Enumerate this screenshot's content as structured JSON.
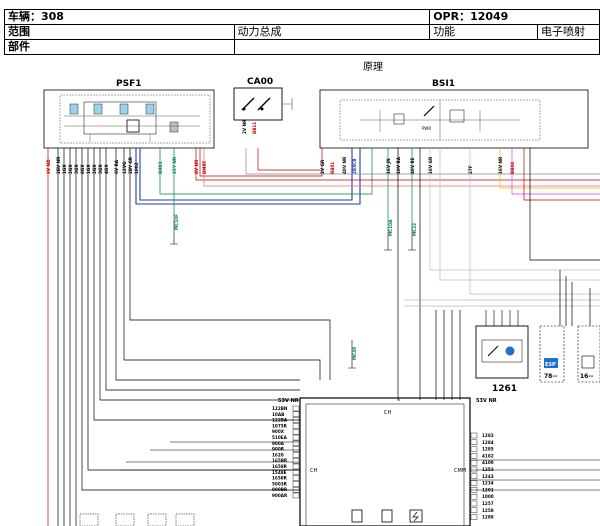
{
  "header": {
    "vehicle_label": "车辆：308",
    "opr_label": "OPR：12049",
    "range_label": "范围",
    "range_value": "动力总成",
    "function_label": "功能",
    "function_value": "电子喷射",
    "component_label": "部件"
  },
  "section_title": "原理",
  "components": {
    "psf1": "PSF1",
    "ca00": "CA00",
    "bsi1": "BSI1",
    "relay_module": "1261",
    "ecu_top": "CH",
    "ecu_left": "CH",
    "ecu_right": "CMM",
    "ecu_bus_left": "53V NR",
    "ecu_bus_right": "53V NR",
    "esp_box": "ESP",
    "esp_code": "78--",
    "right_box_code": "16--"
  },
  "psf1_pins": [
    "6V ND",
    "2BV NR",
    "1GX",
    "2GX",
    "3GX",
    "6GX",
    "1GX",
    "2GX",
    "3GX",
    "4GX",
    "6V BA",
    "12VG",
    "2BY GR",
    "1002",
    "BX03",
    "25Y NR",
    "8V NR",
    "BMRT"
  ],
  "bsi1_pins": [
    "2V GR",
    "BB01",
    "40V NR",
    "2BXCB",
    "16V JN",
    "10V BA",
    "40V BE",
    "16V GR",
    "27F",
    "16V NR",
    "BB04"
  ],
  "ecu_left_pins": [
    "122BN",
    "10AB",
    "122BA",
    "1075R",
    "900X",
    "510EA",
    "900A",
    "900R",
    "1620",
    "165BR",
    "1658R",
    "1548E",
    "1658R",
    "5003R",
    "900BR",
    "900AR"
  ],
  "ecu_right_pins": [
    "1283",
    "1284",
    "1285",
    "4182",
    "4100",
    "1253",
    "1243",
    "1234",
    "1201",
    "1000",
    "1257",
    "1258",
    "1288"
  ],
  "ground_tags": [
    "MC10F",
    "MC10A",
    "MC22",
    "MC49",
    "MC22"
  ]
}
